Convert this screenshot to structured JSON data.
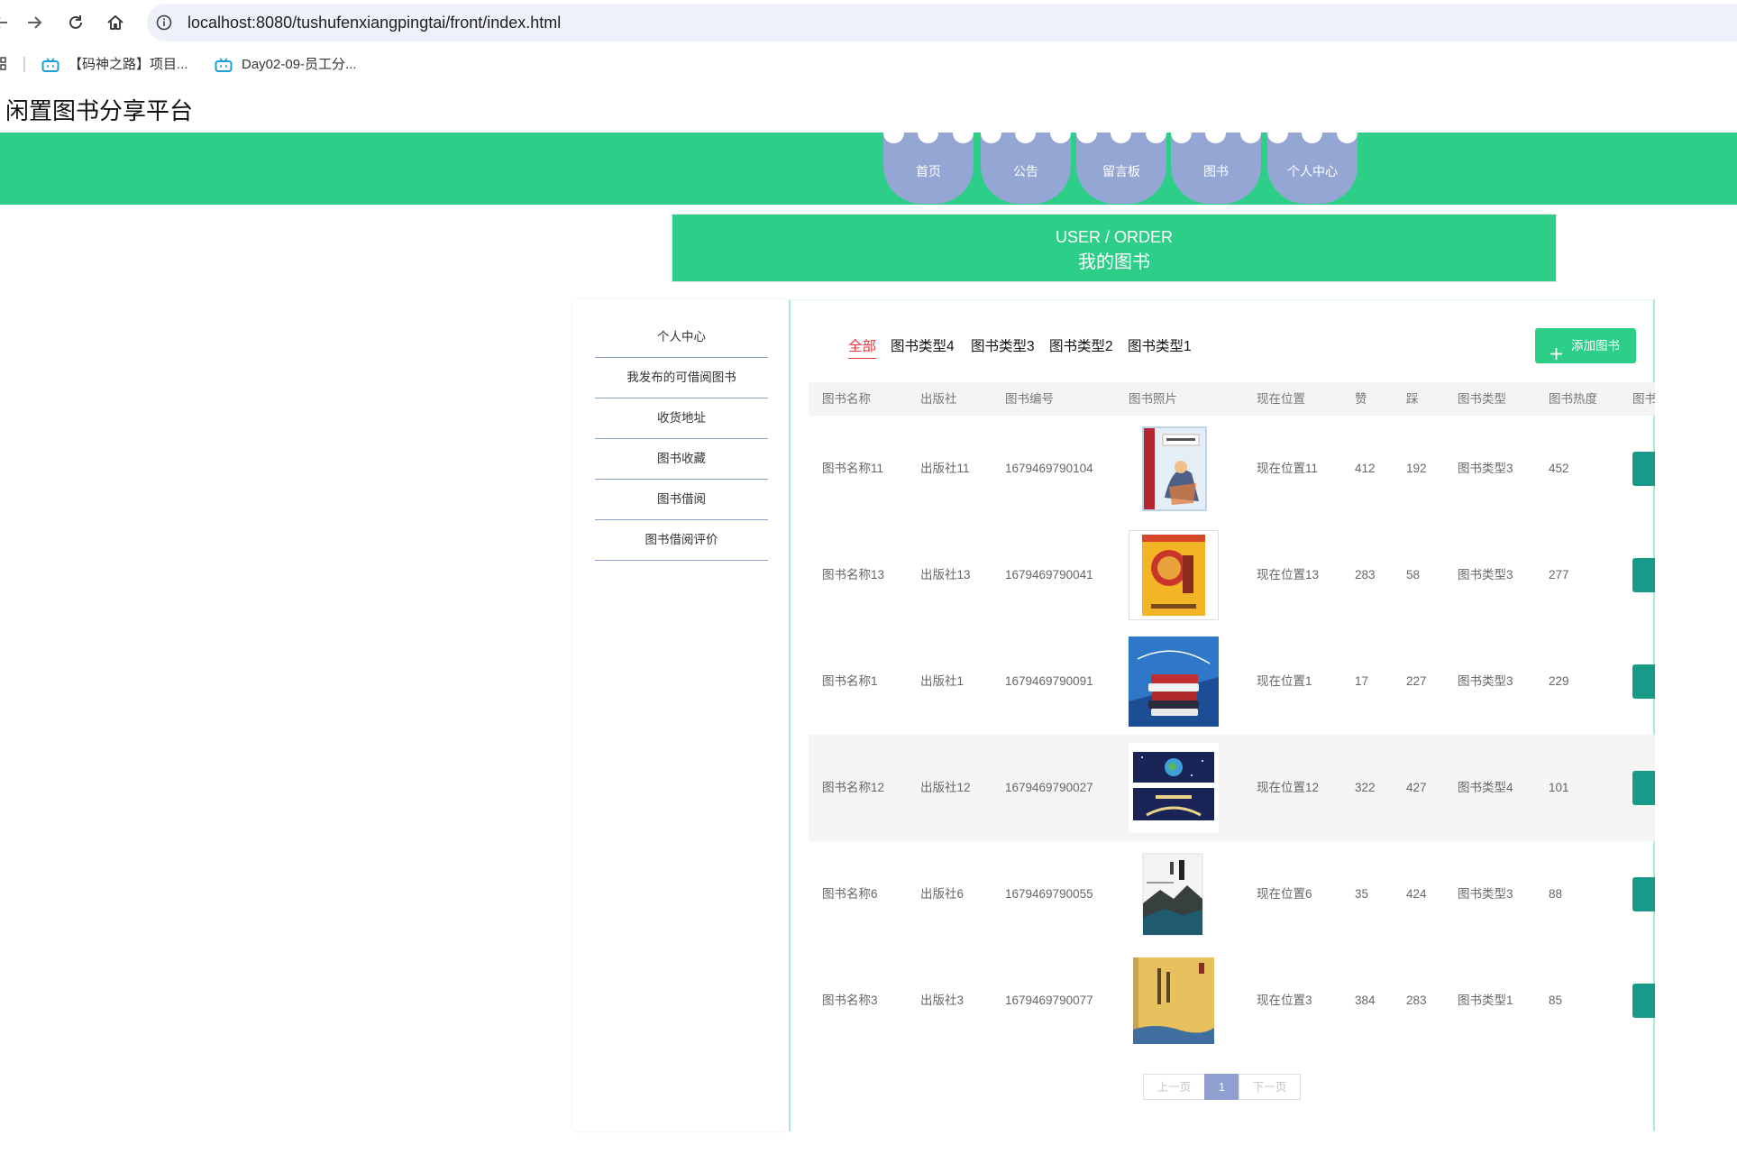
{
  "browser": {
    "url": "localhost:8080/tushufenxiangpingtai/front/index.html",
    "bookmarks": [
      {
        "icon": "tv-icon",
        "label": "【码神之路】项目..."
      },
      {
        "icon": "tv-icon",
        "label": "Day02-09-员工分..."
      }
    ]
  },
  "site_title": "闲置图书分享平台",
  "nav": [
    {
      "label": "首页"
    },
    {
      "label": "公告"
    },
    {
      "label": "留言板"
    },
    {
      "label": "图书"
    },
    {
      "label": "个人中心"
    }
  ],
  "banner": {
    "en": "USER / ORDER",
    "zh": "我的图书"
  },
  "sidebar": [
    {
      "label": "个人中心"
    },
    {
      "label": "我发布的可借阅图书"
    },
    {
      "label": "收货地址"
    },
    {
      "label": "图书收藏"
    },
    {
      "label": "图书借阅"
    },
    {
      "label": "图书借阅评价"
    }
  ],
  "categories": {
    "active": "全部",
    "items": [
      "全部",
      "图书类型4",
      "图书类型3",
      "图书类型2",
      "图书类型1"
    ]
  },
  "add_button": {
    "icon": "plus-icon",
    "label": "添加图书"
  },
  "table": {
    "columns": [
      "图书名称",
      "出版社",
      "图书编号",
      "图书照片",
      "现在位置",
      "赞",
      "踩",
      "图书类型",
      "图书热度",
      "图书"
    ],
    "rows": [
      {
        "name": "图书名称11",
        "publisher": "出版社11",
        "code": "1679469790104",
        "location": "现在位置11",
        "likes": "412",
        "dislikes": "192",
        "type": "图书类型3",
        "heat": "452"
      },
      {
        "name": "图书名称13",
        "publisher": "出版社13",
        "code": "1679469790041",
        "location": "现在位置13",
        "likes": "283",
        "dislikes": "58",
        "type": "图书类型3",
        "heat": "277"
      },
      {
        "name": "图书名称1",
        "publisher": "出版社1",
        "code": "1679469790091",
        "location": "现在位置1",
        "likes": "17",
        "dislikes": "227",
        "type": "图书类型3",
        "heat": "229"
      },
      {
        "name": "图书名称12",
        "publisher": "出版社12",
        "code": "1679469790027",
        "location": "现在位置12",
        "likes": "322",
        "dislikes": "427",
        "type": "图书类型4",
        "heat": "101"
      },
      {
        "name": "图书名称6",
        "publisher": "出版社6",
        "code": "1679469790055",
        "location": "现在位置6",
        "likes": "35",
        "dislikes": "424",
        "type": "图书类型3",
        "heat": "88"
      },
      {
        "name": "图书名称3",
        "publisher": "出版社3",
        "code": "1679469790077",
        "location": "现在位置3",
        "likes": "384",
        "dislikes": "283",
        "type": "图书类型1",
        "heat": "85"
      }
    ]
  },
  "pagination": {
    "prev": "上一页",
    "current": "1",
    "next": "下一页"
  },
  "colors": {
    "primary": "#2dcf88",
    "nav_tab": "#94a6d4",
    "active_category": "#e4393c",
    "page_active": "#8fa0d0",
    "row_button": "#179b88"
  }
}
